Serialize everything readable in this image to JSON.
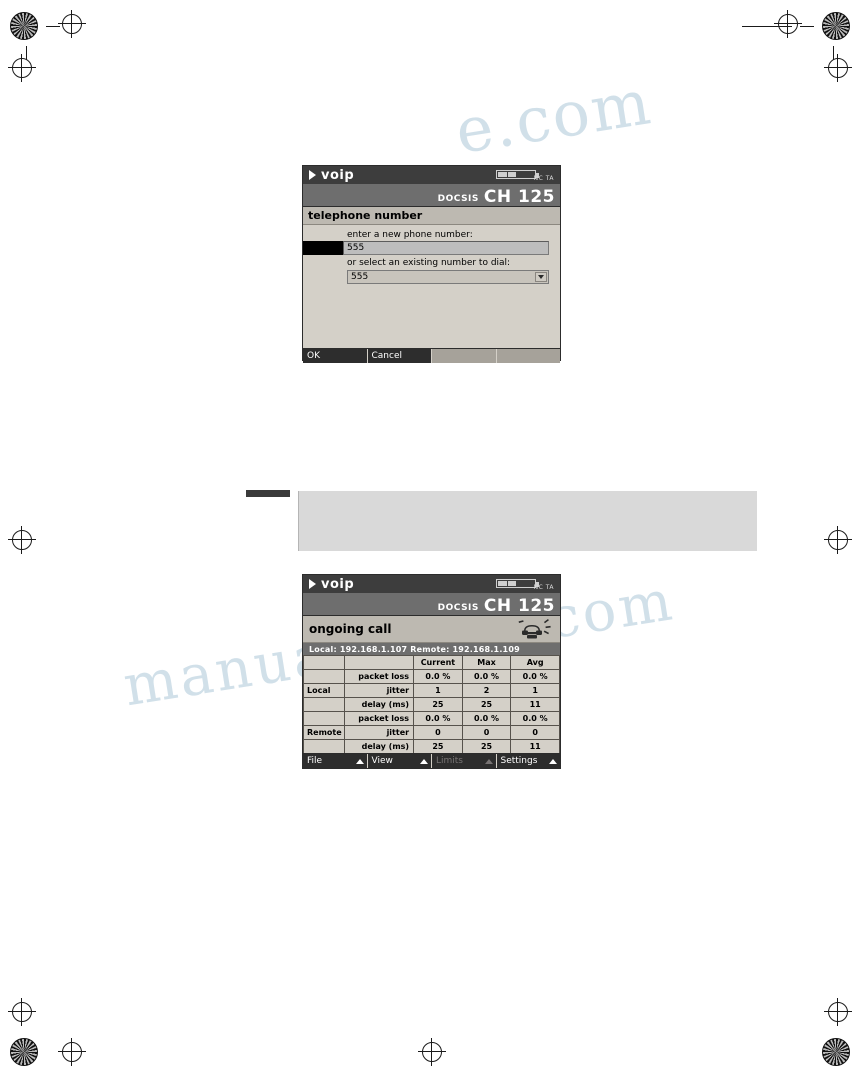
{
  "page": {
    "watermark_line1": "manualsalive.com",
    "watermark_line2": "e.com"
  },
  "dialog_screen": {
    "titlebar": {
      "app_name": "voip",
      "signal_label": "NC TA",
      "battery_icon": "battery-icon",
      "arrow_icon": "play-arrow-icon"
    },
    "channel_bar": {
      "standard": "DOCSIS",
      "channel": "CH 125"
    },
    "header": "telephone number",
    "fields": {
      "new_number_label": "enter a new phone number:",
      "new_number_value": "555",
      "existing_label": "or select an existing number to dial:",
      "existing_value": "555"
    },
    "softkeys": [
      {
        "label": "OK",
        "state": "active"
      },
      {
        "label": "Cancel",
        "state": "active"
      },
      {
        "label": "",
        "state": "empty"
      },
      {
        "label": "",
        "state": "empty"
      }
    ]
  },
  "call_screen": {
    "titlebar": {
      "app_name": "voip",
      "signal_label": "NC TA",
      "battery_icon": "battery-icon",
      "arrow_icon": "play-arrow-icon"
    },
    "channel_bar": {
      "standard": "DOCSIS",
      "channel": "CH 125"
    },
    "header": "ongoing call",
    "phone_icon": "ringing-telephone-icon",
    "addresses": "Local: 192.168.1.107   Remote: 192.168.1.109",
    "stats": {
      "columns": [
        "",
        "",
        "Current",
        "Max",
        "Avg"
      ],
      "groups": [
        {
          "side": "Local",
          "rows": [
            {
              "metric": "packet loss",
              "current": "0.0 %",
              "max": "0.0 %",
              "avg": "0.0 %"
            },
            {
              "metric": "jitter",
              "current": "1",
              "max": "2",
              "avg": "1"
            },
            {
              "metric": "delay (ms)",
              "current": "25",
              "max": "25",
              "avg": "11"
            }
          ]
        },
        {
          "side": "Remote",
          "rows": [
            {
              "metric": "packet loss",
              "current": "0.0 %",
              "max": "0.0 %",
              "avg": "0.0 %"
            },
            {
              "metric": "jitter",
              "current": "0",
              "max": "0",
              "avg": "0"
            },
            {
              "metric": "delay (ms)",
              "current": "25",
              "max": "25",
              "avg": "11"
            }
          ]
        }
      ]
    },
    "menubar": [
      {
        "label": "File",
        "state": "active"
      },
      {
        "label": "View",
        "state": "active"
      },
      {
        "label": "Limits",
        "state": "disabled"
      },
      {
        "label": "Settings",
        "state": "active"
      }
    ]
  }
}
